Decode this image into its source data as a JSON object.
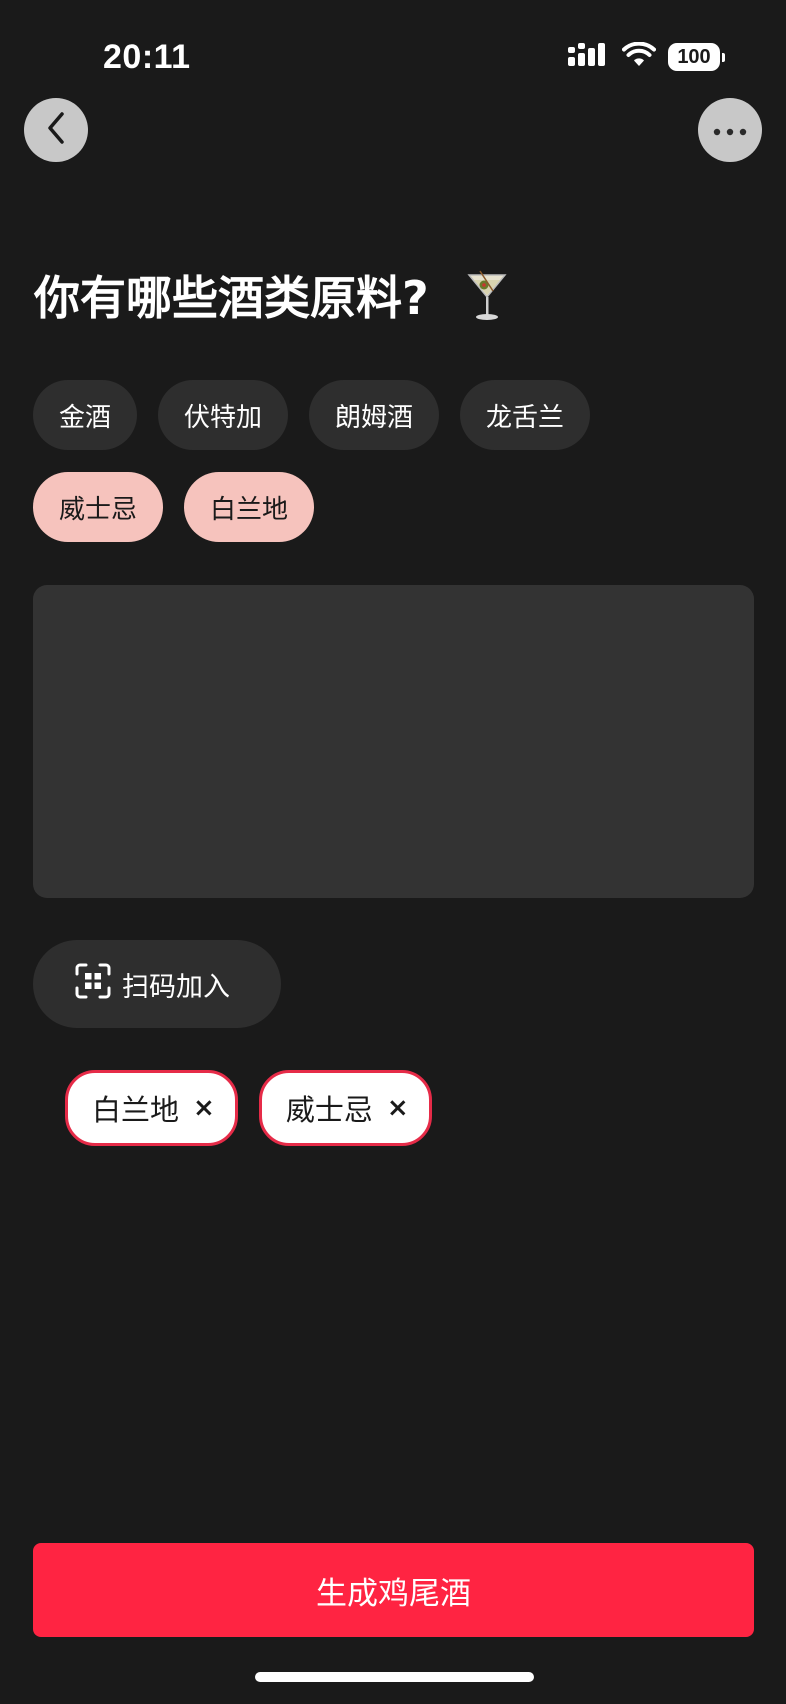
{
  "status_bar": {
    "time": "20:11",
    "battery": "100"
  },
  "icons": {
    "back": "chevron-left-icon",
    "more": "more-horizontal-icon",
    "cocktail": "cocktail-glass-icon",
    "scan": "scan-qr-icon",
    "close": "close-icon"
  },
  "title": "你有哪些酒类原料?",
  "chips": [
    {
      "label": "金酒",
      "selected": false
    },
    {
      "label": "伏特加",
      "selected": false
    },
    {
      "label": "朗姆酒",
      "selected": false
    },
    {
      "label": "龙舌兰",
      "selected": false
    },
    {
      "label": "威士忌",
      "selected": true
    },
    {
      "label": "白兰地",
      "selected": true
    }
  ],
  "input": {
    "value": "",
    "placeholder": ""
  },
  "scan_button": {
    "label": "扫码加入"
  },
  "selected_tags": [
    {
      "label": "白兰地",
      "close": "×"
    },
    {
      "label": "威士忌",
      "close": "×"
    }
  ],
  "generate_button": {
    "label": "生成鸡尾酒"
  },
  "colors": {
    "background": "#1a1a1a",
    "chip": "#2e2e2e",
    "chip_selected": "#f6c3bd",
    "accent": "#ff2442",
    "tag_border": "#e62b48"
  }
}
